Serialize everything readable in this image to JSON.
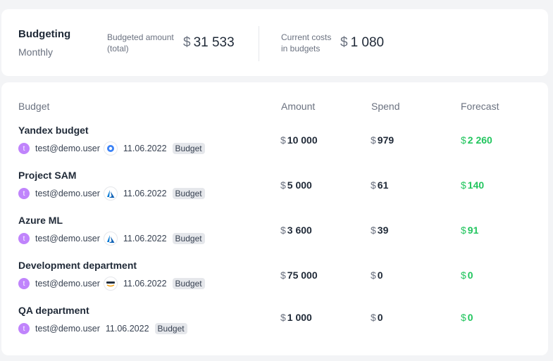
{
  "summary": {
    "title": "Budgeting",
    "period": "Monthly",
    "budgeted_label_line1": "Budgeted amount",
    "budgeted_label_line2": "(total)",
    "budgeted_value": "31 533",
    "current_label_line1": "Current costs",
    "current_label_line2": "in budgets",
    "current_value": "1 080",
    "currency": "$"
  },
  "table": {
    "headers": {
      "budget": "Budget",
      "amount": "Amount",
      "spend": "Spend",
      "forecast": "Forecast"
    },
    "rows": [
      {
        "name": "Yandex budget",
        "avatar": "t",
        "user": "test@demo.user",
        "provider_icon": "yandex-cloud-icon",
        "date": "11.06.2022",
        "badge": "Budget",
        "amount": "10 000",
        "spend": "979",
        "forecast": "2 260"
      },
      {
        "name": "Project SAM",
        "avatar": "t",
        "user": "test@demo.user",
        "provider_icon": "azure-icon",
        "date": "11.06.2022",
        "badge": "Budget",
        "amount": "5 000",
        "spend": "61",
        "forecast": "140"
      },
      {
        "name": "Azure ML",
        "avatar": "t",
        "user": "test@demo.user",
        "provider_icon": "azure-icon",
        "date": "11.06.2022",
        "badge": "Budget",
        "amount": "3 600",
        "spend": "39",
        "forecast": "91"
      },
      {
        "name": "Development department",
        "avatar": "t",
        "user": "test@demo.user",
        "provider_icon": "aws-icon",
        "date": "11.06.2022",
        "badge": "Budget",
        "amount": "75 000",
        "spend": "0",
        "forecast": "0"
      },
      {
        "name": "QA department",
        "avatar": "t",
        "user": "test@demo.user",
        "provider_icon": "",
        "date": "11.06.2022",
        "badge": "Budget",
        "amount": "1 000",
        "spend": "0",
        "forecast": "0"
      }
    ]
  },
  "colors": {
    "forecast": "#22c55e",
    "avatar": "#c084fc",
    "azure": "#0078d4",
    "yandex": "#3b82f6",
    "aws": "#f59e0b"
  }
}
